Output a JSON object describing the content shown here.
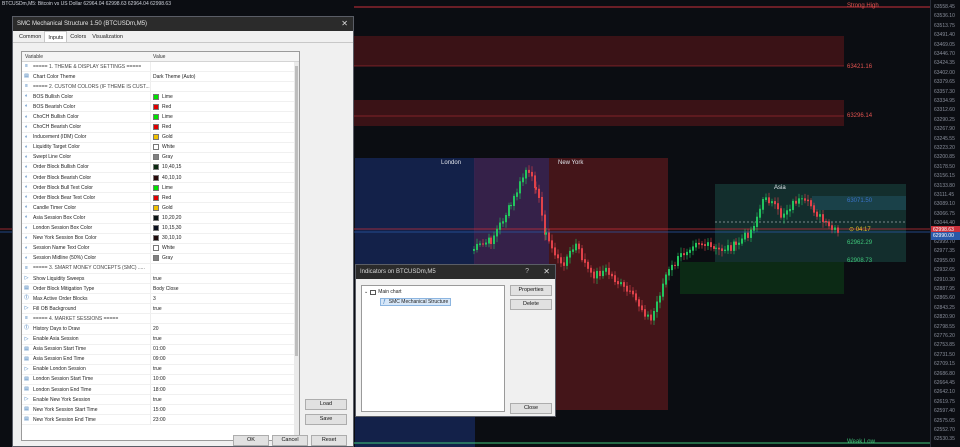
{
  "chart": {
    "title": "BTCUSDm,M5: Bitcoin vs US Dollar  62964.04 62998.63 62964.04 62998.63",
    "strong_high": "Strong High",
    "weak_low": "Weak Low",
    "levels": [
      {
        "label": "63421.16",
        "price": 63421.16,
        "color": "#e0524f"
      },
      {
        "label": "63296.14",
        "price": 63296.14,
        "color": "#e0524f"
      },
      {
        "label": "63071.50",
        "price": 63071.5,
        "color": "#3a72c8"
      },
      {
        "label": "62962.29",
        "price": 62962.29,
        "color": "#3fc67a"
      },
      {
        "label": "62908.73",
        "price": 62908.73,
        "color": "#3fc67a"
      }
    ],
    "sessions": [
      {
        "label": "London",
        "color": "#1e3a78"
      },
      {
        "label": "New York",
        "color": "#5a1e23"
      },
      {
        "label": "Asia",
        "color": "#173a3a"
      }
    ],
    "marker": {
      "label": "04:17",
      "color": "#e6c229"
    },
    "axis_ticks": [
      "63558.45",
      "63536.10",
      "63513.75",
      "63491.40",
      "63469.05",
      "63446.70",
      "63424.35",
      "63402.00",
      "63379.65",
      "63357.30",
      "63334.95",
      "63312.60",
      "63290.25",
      "63267.90",
      "63245.55",
      "63223.20",
      "63200.85",
      "63178.50",
      "63156.15",
      "63133.80",
      "63111.45",
      "63089.10",
      "63066.75",
      "63044.40",
      "63022.05",
      "62999.70",
      "62977.35",
      "62955.00",
      "62932.65",
      "62910.30",
      "62887.95",
      "62865.60",
      "62843.25",
      "62820.90",
      "62798.55",
      "62776.20",
      "62753.85",
      "62731.50",
      "62709.15",
      "62686.80",
      "62664.45",
      "62642.10",
      "62619.75",
      "62597.40",
      "62575.05",
      "62552.70",
      "62530.35"
    ],
    "axis_tags": [
      {
        "label": "62998.63",
        "color": "#c9303a"
      },
      {
        "label": "62990.00",
        "color": "#2a59a8"
      }
    ]
  },
  "dialog": {
    "title": "SMC Mechanical Structure 1.50 (BTCUSDm,M5)",
    "close": "✕",
    "tabs": [
      "Common",
      "Inputs",
      "Colors",
      "Visualization"
    ],
    "active_tab": "Inputs",
    "col_variable": "Variable",
    "col_value": "Value",
    "rows": [
      {
        "kind": "header",
        "name": "===== 1. THEME & DISPLAY SETTINGS =====",
        "value": ""
      },
      {
        "kind": "enum",
        "name": "Chart Color Theme",
        "value": "Dark Theme (Auto)"
      },
      {
        "kind": "header",
        "name": "===== 2. CUSTOM COLORS (IF THEME IS CUST...",
        "value": ""
      },
      {
        "kind": "color",
        "name": "BOS Bullish Color",
        "value": "Lime",
        "swatch": "#00e000"
      },
      {
        "kind": "color",
        "name": "BOS Bearish Color",
        "value": "Red",
        "swatch": "#e00000"
      },
      {
        "kind": "color",
        "name": "ChoCH Bullish Color",
        "value": "Lime",
        "swatch": "#00e000"
      },
      {
        "kind": "color",
        "name": "ChoCH Bearish Color",
        "value": "Red",
        "swatch": "#e00000"
      },
      {
        "kind": "color",
        "name": "Inducement (IDM) Color",
        "value": "Gold",
        "swatch": "#f0c000"
      },
      {
        "kind": "color",
        "name": "Liquidity Target Color",
        "value": "White",
        "swatch": "#ffffff"
      },
      {
        "kind": "color",
        "name": "Swept Line Color",
        "value": "Gray",
        "swatch": "#808080"
      },
      {
        "kind": "color",
        "name": "Order Block Bullish Color",
        "value": "10,40,15",
        "swatch": "#0a280f"
      },
      {
        "kind": "color",
        "name": "Order Block Bearish Color",
        "value": "40,10,10",
        "swatch": "#280a0a"
      },
      {
        "kind": "color",
        "name": "Order Block Bull Text Color",
        "value": "Lime",
        "swatch": "#00e000"
      },
      {
        "kind": "color",
        "name": "Order Block Bear Text Color",
        "value": "Red",
        "swatch": "#e00000"
      },
      {
        "kind": "color",
        "name": "Candle Timer Color",
        "value": "Gold",
        "swatch": "#f0c000"
      },
      {
        "kind": "color",
        "name": "Asia Session Box Color",
        "value": "10,20,20",
        "swatch": "#0a1414"
      },
      {
        "kind": "color",
        "name": "London Session Box Color",
        "value": "10,15,30",
        "swatch": "#0a0f1e"
      },
      {
        "kind": "color",
        "name": "New York Session Box Color",
        "value": "30,10,10",
        "swatch": "#1e0a0a"
      },
      {
        "kind": "color",
        "name": "Session Name Text Color",
        "value": "White",
        "swatch": "#ffffff"
      },
      {
        "kind": "color",
        "name": "Session Midline (50%) Color",
        "value": "Gray",
        "swatch": "#808080"
      },
      {
        "kind": "header",
        "name": "===== 3. SMART MONEY CONCEPTS (SMC) .....",
        "value": ""
      },
      {
        "kind": "bool",
        "name": "Show Liquidity Sweeps",
        "value": "true"
      },
      {
        "kind": "enum",
        "name": "Order Block Mitigation Type",
        "value": "Body Close"
      },
      {
        "kind": "num",
        "name": "Max Active Order Blocks",
        "value": "3"
      },
      {
        "kind": "bool",
        "name": "Fill OB Background",
        "value": "true"
      },
      {
        "kind": "header",
        "name": "===== 4. MARKET SESSIONS =====",
        "value": ""
      },
      {
        "kind": "num",
        "name": "History Days to Draw",
        "value": "20"
      },
      {
        "kind": "bool",
        "name": "Enable Asia Session",
        "value": "true"
      },
      {
        "kind": "enum",
        "name": "Asia Session Start Time",
        "value": "01:00"
      },
      {
        "kind": "enum",
        "name": "Asia Session End Time",
        "value": "09:00"
      },
      {
        "kind": "bool",
        "name": "Enable London Session",
        "value": "true"
      },
      {
        "kind": "enum",
        "name": "London Session Start Time",
        "value": "10:00"
      },
      {
        "kind": "enum",
        "name": "London Session End Time",
        "value": "18:00"
      },
      {
        "kind": "bool",
        "name": "Enable New York Session",
        "value": "true"
      },
      {
        "kind": "enum",
        "name": "New York Session Start Time",
        "value": "15:00"
      },
      {
        "kind": "enum",
        "name": "New York Session End Time",
        "value": "23:00"
      }
    ],
    "load": "Load",
    "save": "Save",
    "ok": "OK",
    "cancel": "Cancel",
    "reset": "Reset"
  },
  "indicators": {
    "title": "Indicators on BTCUSDm,M5",
    "help": "?",
    "close": "✕",
    "tree_root": "Main chart",
    "tree_item": "SMC Mechanical Structure",
    "properties": "Properties",
    "delete": "Delete",
    "close_btn": "Close"
  }
}
